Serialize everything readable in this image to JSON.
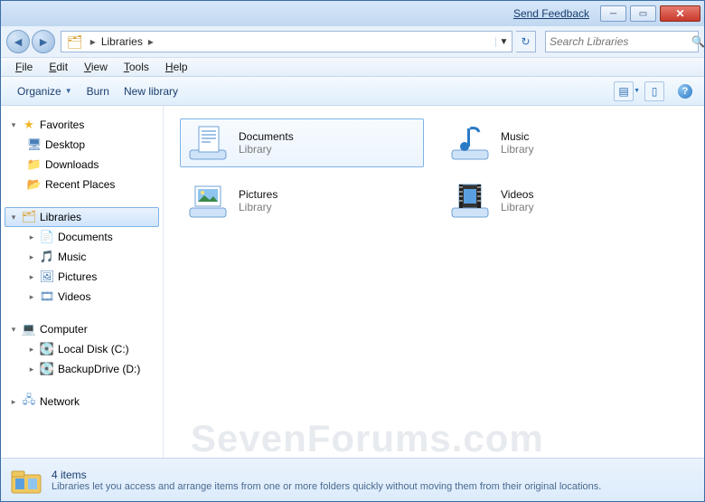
{
  "titlebar": {
    "feedback": "Send Feedback"
  },
  "breadcrumb": {
    "root_sep": "▸",
    "current": "Libraries",
    "after_sep": "▸"
  },
  "search": {
    "placeholder": "Search Libraries"
  },
  "menu": {
    "file": "File",
    "edit": "Edit",
    "view": "View",
    "tools": "Tools",
    "help": "Help"
  },
  "toolbar": {
    "organize": "Organize",
    "burn": "Burn",
    "newlib": "New library"
  },
  "sidebar": {
    "favorites": {
      "label": "Favorites",
      "items": [
        {
          "label": "Desktop"
        },
        {
          "label": "Downloads"
        },
        {
          "label": "Recent Places"
        }
      ]
    },
    "libraries": {
      "label": "Libraries",
      "items": [
        {
          "label": "Documents"
        },
        {
          "label": "Music"
        },
        {
          "label": "Pictures"
        },
        {
          "label": "Videos"
        }
      ]
    },
    "computer": {
      "label": "Computer",
      "items": [
        {
          "label": "Local Disk (C:)"
        },
        {
          "label": "BackupDrive (D:)"
        }
      ]
    },
    "network": {
      "label": "Network"
    }
  },
  "content": {
    "tiles": [
      {
        "name": "Documents",
        "sub": "Library",
        "selected": true
      },
      {
        "name": "Music",
        "sub": "Library",
        "selected": false
      },
      {
        "name": "Pictures",
        "sub": "Library",
        "selected": false
      },
      {
        "name": "Videos",
        "sub": "Library",
        "selected": false
      }
    ]
  },
  "status": {
    "count": "4 items",
    "desc": "Libraries let you access and arrange items from one or more folders quickly without moving them from their original locations."
  },
  "watermark": "SevenForums.com"
}
